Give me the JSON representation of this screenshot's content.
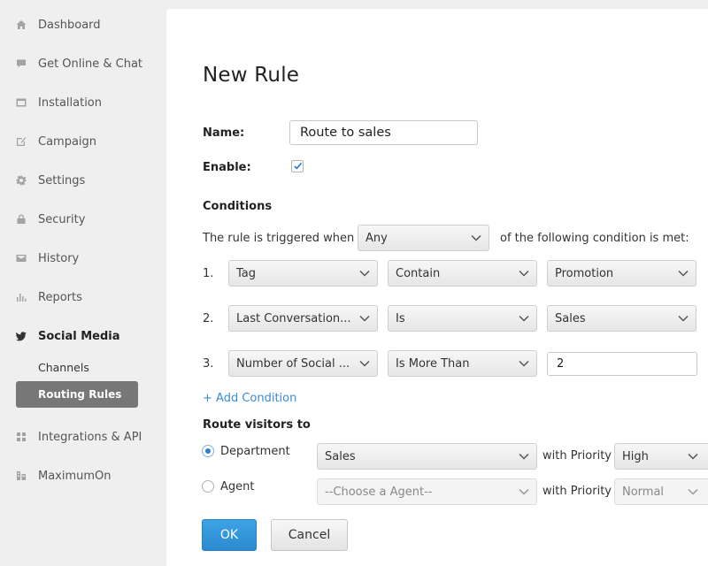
{
  "sidebar": {
    "items": [
      {
        "label": "Dashboard",
        "icon": "home-icon"
      },
      {
        "label": "Get Online & Chat",
        "icon": "chat-icon"
      },
      {
        "label": "Installation",
        "icon": "installation-icon"
      },
      {
        "label": "Campaign",
        "icon": "campaign-icon"
      },
      {
        "label": "Settings",
        "icon": "gear-icon"
      },
      {
        "label": "Security",
        "icon": "lock-icon"
      },
      {
        "label": "History",
        "icon": "history-icon"
      },
      {
        "label": "Reports",
        "icon": "reports-icon"
      },
      {
        "label": "Social Media",
        "icon": "twitter-icon"
      },
      {
        "label": "Integrations & API",
        "icon": "integrations-icon"
      },
      {
        "label": "MaximumOn",
        "icon": "maximumon-icon"
      }
    ],
    "sub_items": [
      {
        "label": "Channels"
      },
      {
        "label": "Routing Rules"
      }
    ]
  },
  "form": {
    "title": "New Rule",
    "name_label": "Name:",
    "name_value": "Route to sales",
    "enable_label": "Enable:",
    "enable_checked": true,
    "conditions_title": "Conditions",
    "trigger_prefix": "The rule is triggered when",
    "trigger_value": "Any",
    "trigger_suffix": "of the following condition is met:",
    "conditions": [
      {
        "num": "1.",
        "field": "Tag",
        "operator": "Contain",
        "value": "Promotion"
      },
      {
        "num": "2.",
        "field": "Last Conversation...",
        "operator": "Is",
        "value": "Sales"
      },
      {
        "num": "3.",
        "field": "Number of Social ...",
        "operator": "Is More Than",
        "value": "2"
      }
    ],
    "add_condition": "+ Add Condition",
    "route_title": "Route visitors to",
    "department_label": "Department",
    "department_value": "Sales",
    "agent_label": "Agent",
    "agent_placeholder": "--Choose a Agent--",
    "with_priority": "with Priority",
    "department_priority": "High",
    "agent_priority": "Normal",
    "ok_label": "OK",
    "cancel_label": "Cancel"
  },
  "colors": {
    "primary": "#2b8ad0",
    "link": "#3a8bd6",
    "selected_nav": "#777777"
  }
}
